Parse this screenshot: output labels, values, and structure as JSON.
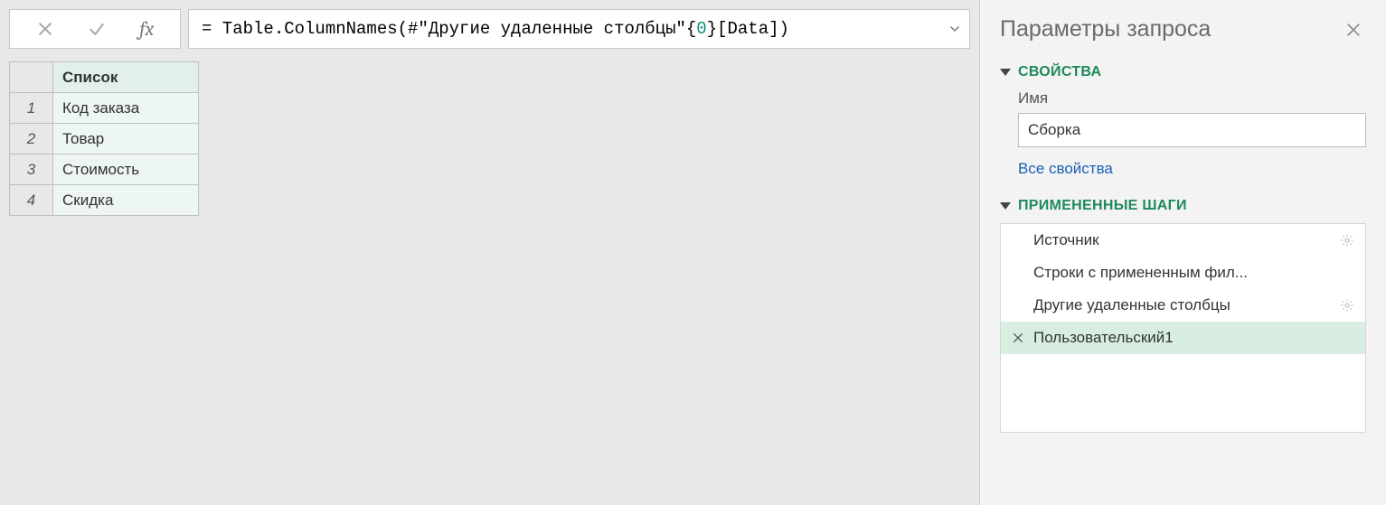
{
  "formula_bar": {
    "cancel_icon": "cancel",
    "confirm_icon": "check",
    "fx_label": "fx",
    "formula_prefix": "= Table.ColumnNames(#\"Другие удаленные столбцы\"{",
    "formula_num": "0",
    "formula_suffix": "}[Data])"
  },
  "list": {
    "header": "Список",
    "rows": [
      {
        "n": "1",
        "v": "Код заказа"
      },
      {
        "n": "2",
        "v": "Товар"
      },
      {
        "n": "3",
        "v": "Стоимость"
      },
      {
        "n": "4",
        "v": "Скидка"
      }
    ]
  },
  "panel": {
    "title": "Параметры запроса",
    "properties": {
      "heading": "СВОЙСТВА",
      "name_label": "Имя",
      "name_value": "Сборка",
      "all_props": "Все свойства"
    },
    "steps": {
      "heading": "ПРИМЕНЕННЫЕ ШАГИ",
      "items": [
        {
          "label": "Источник",
          "gear": true,
          "selected": false
        },
        {
          "label": "Строки с примененным фил...",
          "gear": false,
          "selected": false
        },
        {
          "label": "Другие удаленные столбцы",
          "gear": true,
          "selected": false
        },
        {
          "label": "Пользовательский1",
          "gear": false,
          "selected": true
        }
      ]
    }
  }
}
